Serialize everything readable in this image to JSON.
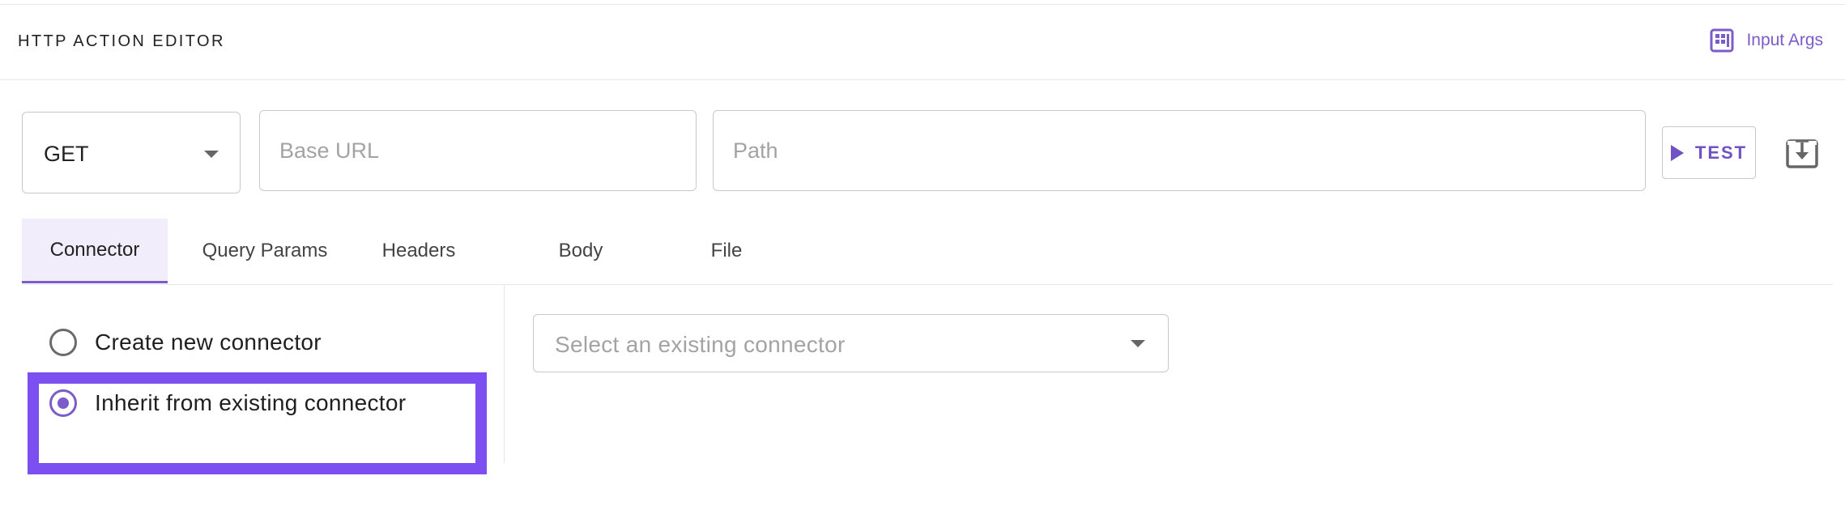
{
  "header": {
    "title": "HTTP ACTION EDITOR",
    "input_args_label": "Input Args"
  },
  "request": {
    "method": "GET",
    "base_url_placeholder": "Base URL",
    "path_placeholder": "Path",
    "test_label": "TEST"
  },
  "tabs": [
    {
      "label": "Connector",
      "active": true
    },
    {
      "label": "Query Params",
      "active": false
    },
    {
      "label": "Headers",
      "active": false
    },
    {
      "label": "Body",
      "active": false
    },
    {
      "label": "File",
      "active": false
    }
  ],
  "connector": {
    "options": [
      {
        "label": "Create new connector",
        "selected": false
      },
      {
        "label": "Inherit from existing connector",
        "selected": true
      }
    ],
    "select_placeholder": "Select an existing connector"
  },
  "colors": {
    "accent": "#7b5cc8",
    "highlight_box": "#7b4ff0"
  },
  "icons": [
    "input-args-icon",
    "chevron-down-icon",
    "play-icon",
    "download-icon"
  ]
}
